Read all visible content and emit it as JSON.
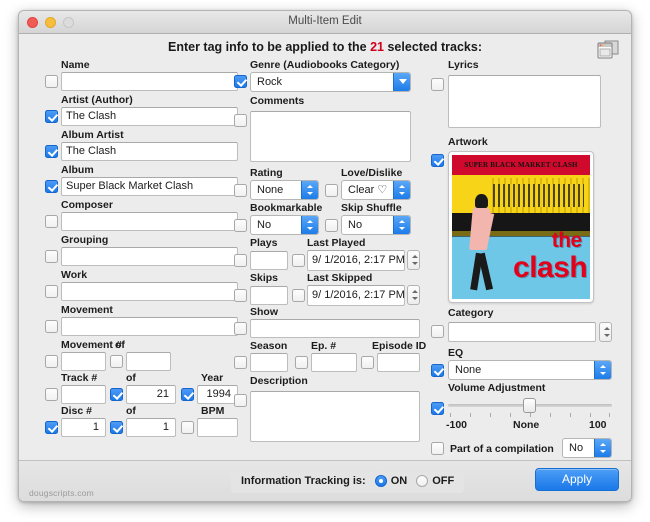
{
  "window": {
    "title": "Multi-Item Edit",
    "watermark": "dougscripts.com",
    "controls": {
      "close": "close-button",
      "minimize": "minimize-button",
      "zoom": "zoom-button"
    }
  },
  "header": {
    "prefix": "Enter tag info to be applied to the",
    "count": "21",
    "suffix": "selected tracks:",
    "icon": "windows-icon"
  },
  "left_column": {
    "name": {
      "label": "Name",
      "value": "",
      "checked": false
    },
    "artist": {
      "label": "Artist (Author)",
      "value": "The Clash",
      "checked": true
    },
    "album_artist": {
      "label": "Album Artist",
      "value": "The Clash",
      "checked": true
    },
    "album": {
      "label": "Album",
      "value": "Super Black Market Clash",
      "checked": true
    },
    "composer": {
      "label": "Composer",
      "value": "",
      "checked": false
    },
    "grouping": {
      "label": "Grouping",
      "value": "",
      "checked": false
    },
    "work": {
      "label": "Work",
      "value": "",
      "checked": false
    },
    "movement": {
      "label": "Movement",
      "value": "",
      "checked": false
    },
    "movement_num": {
      "label": "Movement #",
      "value": "",
      "checked": false
    },
    "movement_of": {
      "label": "of",
      "value": "",
      "checked": false
    },
    "track_num": {
      "label": "Track #",
      "value": "",
      "checked": false
    },
    "track_of": {
      "label": "of",
      "value": "21",
      "checked": true
    },
    "year": {
      "label": "Year",
      "value": "1994",
      "checked": true
    },
    "disc_num": {
      "label": "Disc #",
      "value": "1",
      "checked": true
    },
    "disc_of": {
      "label": "of",
      "value": "1",
      "checked": true
    },
    "bpm": {
      "label": "BPM",
      "value": "",
      "checked": false
    }
  },
  "middle_column": {
    "genre": {
      "label": "Genre (Audiobooks Category)",
      "value": "Rock",
      "checked": true
    },
    "comments": {
      "label": "Comments",
      "value": "",
      "checked": false
    },
    "rating": {
      "label": "Rating",
      "value": "None",
      "checked": false
    },
    "love_dislike": {
      "label": "Love/Dislike",
      "value": "Clear ♡",
      "checked": false
    },
    "bookmarkable": {
      "label": "Bookmarkable",
      "value": "No",
      "checked": false
    },
    "skip_shuffle": {
      "label": "Skip Shuffle",
      "value": "No",
      "checked": false
    },
    "plays": {
      "label": "Plays",
      "value": "",
      "checked": false
    },
    "last_played": {
      "label": "Last Played",
      "value": "9/  1/2016,  2:17 PM",
      "checked": false
    },
    "skips": {
      "label": "Skips",
      "value": "",
      "checked": false
    },
    "last_skipped": {
      "label": "Last Skipped",
      "value": "9/  1/2016,  2:17 PM",
      "checked": false
    },
    "show": {
      "label": "Show",
      "value": "",
      "checked": false
    },
    "season": {
      "label": "Season",
      "value": "",
      "checked": false
    },
    "episode_num": {
      "label": "Ep. #",
      "value": "",
      "checked": false
    },
    "episode_id": {
      "label": "Episode ID",
      "value": "",
      "checked": false
    },
    "description": {
      "label": "Description",
      "value": "",
      "checked": false
    }
  },
  "right_column": {
    "lyrics": {
      "label": "Lyrics",
      "value": "",
      "checked": false
    },
    "artwork": {
      "label": "Artwork",
      "checked": true,
      "album_title": "SUPER BLACK MARKET CLASH",
      "band_line1": "the",
      "band_line2": "clash"
    },
    "category": {
      "label": "Category",
      "value": "",
      "checked": false
    },
    "eq": {
      "label": "EQ",
      "value": "None",
      "checked": true
    },
    "volume_adjustment": {
      "label": "Volume Adjustment",
      "checked": true,
      "min_label": "-100",
      "center_label": "None",
      "max_label": "100",
      "value": 0
    },
    "compilation": {
      "label": "Part of a compilation",
      "value": "No",
      "checked": false
    }
  },
  "footer": {
    "tracking_label": "Information Tracking is:",
    "on_label": "ON",
    "off_label": "OFF",
    "tracking_value": "ON",
    "apply_label": "Apply"
  },
  "colors": {
    "accent_blue": "#1a78e8",
    "count_red": "#d0021b",
    "window_bg": "#ececec"
  }
}
